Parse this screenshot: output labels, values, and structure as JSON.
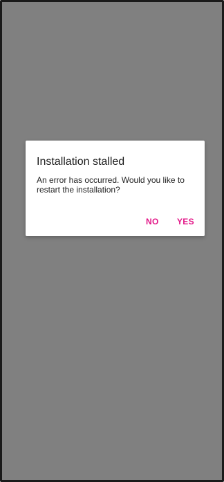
{
  "dialog": {
    "title": "Installation stalled",
    "message": "An error has occurred. Would you like to restart the installation?",
    "buttons": {
      "no_label": "NO",
      "yes_label": "YES"
    }
  },
  "colors": {
    "scrim": "#808080",
    "dialog_background": "#ffffff",
    "accent": "#e21587"
  }
}
